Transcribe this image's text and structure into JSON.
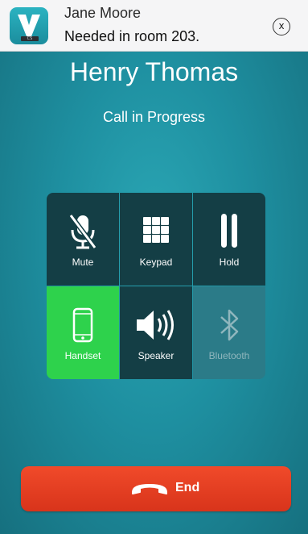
{
  "notification": {
    "sender": "Jane Moore",
    "message": "Needed in room 203.",
    "close_label": "x",
    "app_icon": "vocera-cs-app-icon",
    "app_icon_badge": "CS"
  },
  "call": {
    "caller_name": "Henry Thomas",
    "status": "Call in Progress"
  },
  "controls": [
    {
      "label": "Mute",
      "icon": "mic-muted-icon",
      "state": "normal"
    },
    {
      "label": "Keypad",
      "icon": "keypad-icon",
      "state": "normal"
    },
    {
      "label": "Hold",
      "icon": "pause-icon",
      "state": "normal"
    },
    {
      "label": "Handset",
      "icon": "phone-handset-icon",
      "state": "selected"
    },
    {
      "label": "Speaker",
      "icon": "speaker-icon",
      "state": "normal"
    },
    {
      "label": "Bluetooth",
      "icon": "bluetooth-icon",
      "state": "disabled"
    }
  ],
  "end_button": {
    "label": "End",
    "icon": "hang-up-icon"
  },
  "colors": {
    "background": "#1e8fa0",
    "tile_dark": "#143e45",
    "tile_selected": "#2ed24c",
    "tile_disabled": "#2b7b88",
    "end_button": "#e23d22"
  }
}
